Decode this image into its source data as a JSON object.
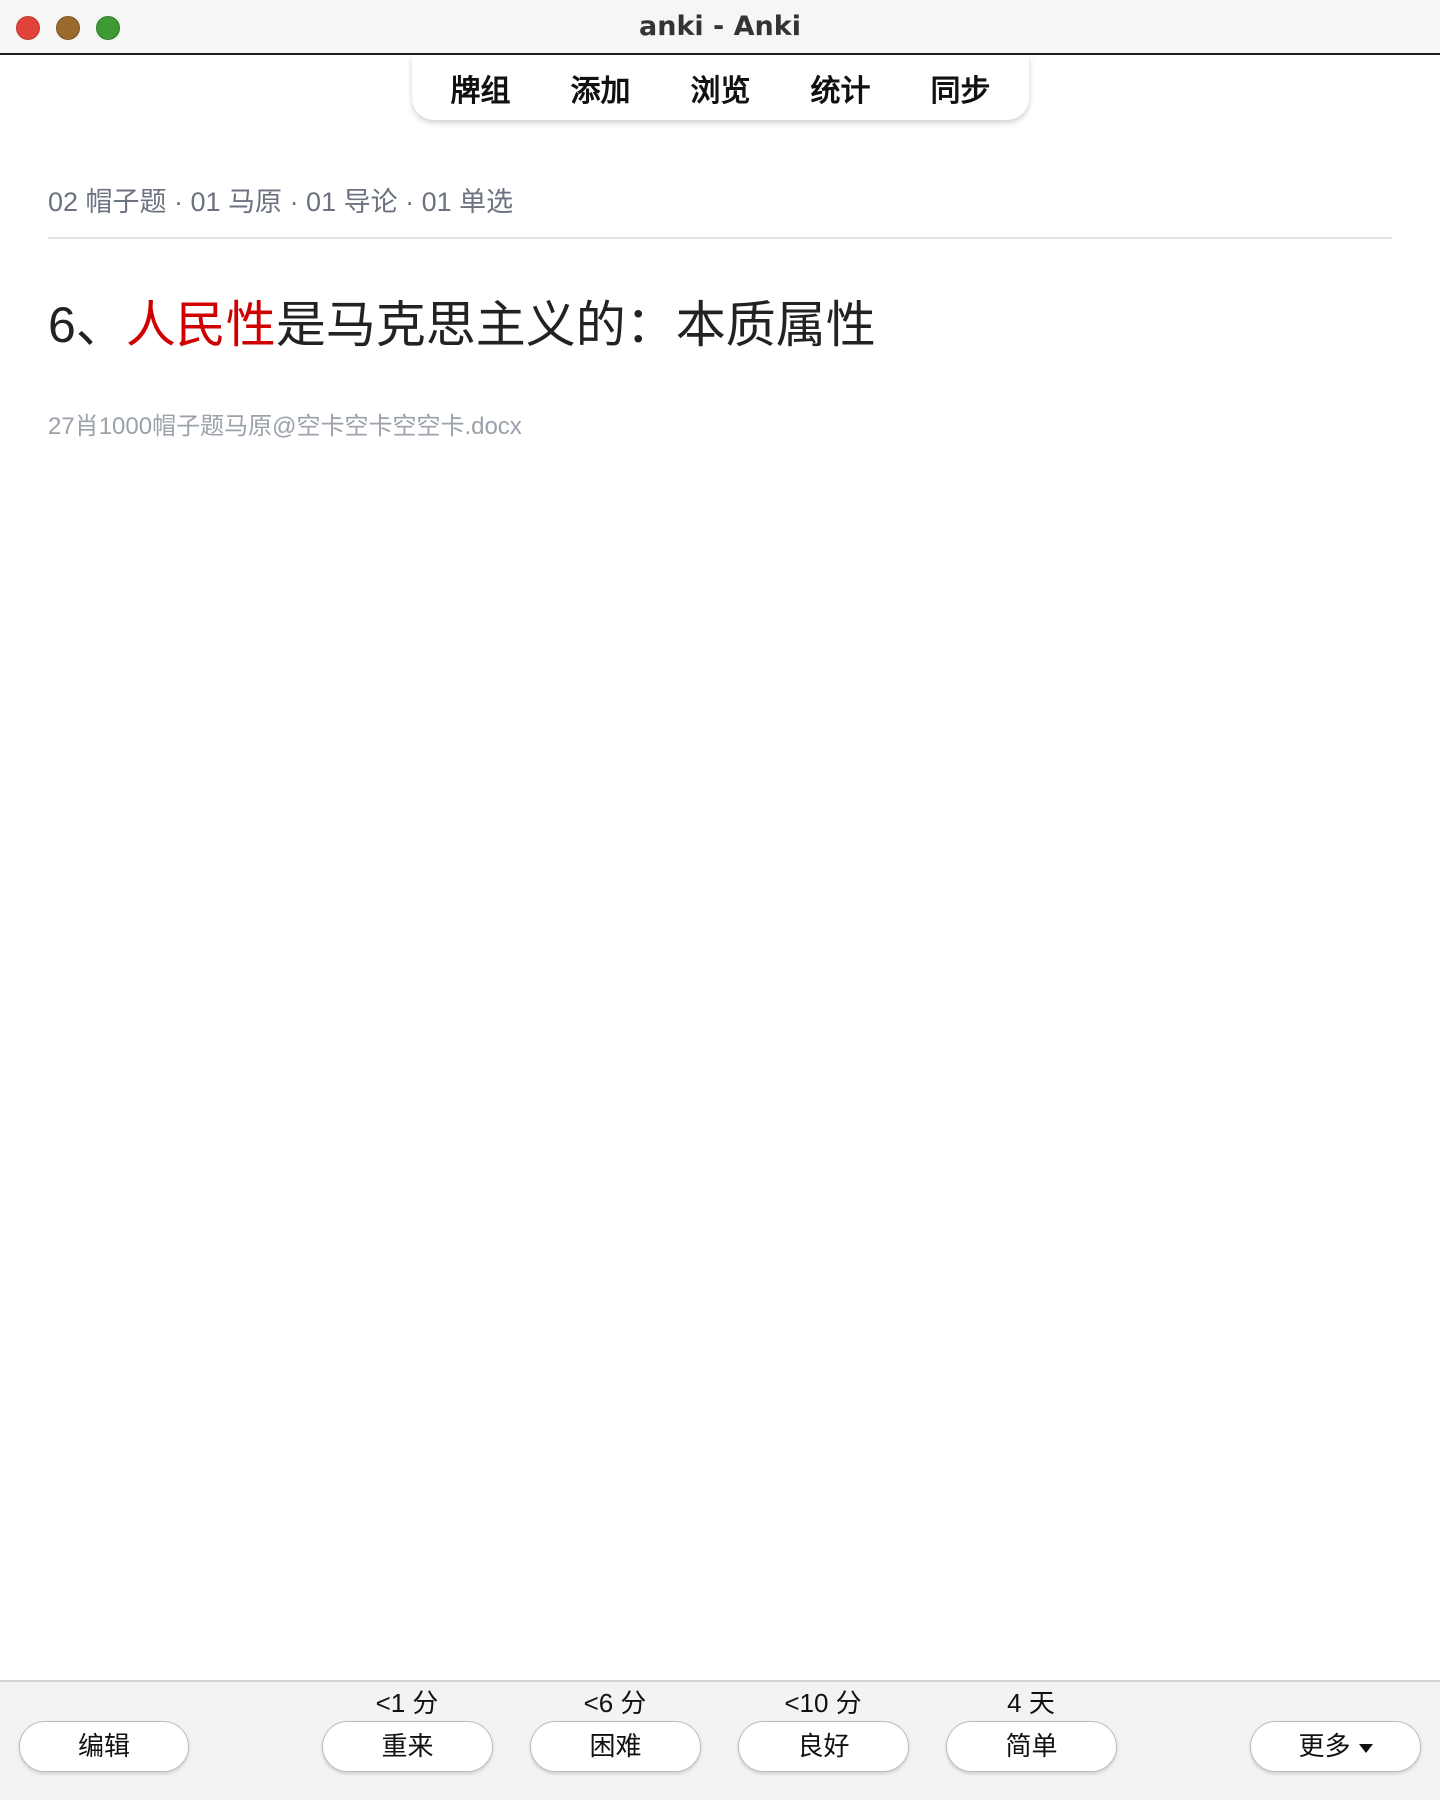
{
  "window": {
    "title": "anki - Anki"
  },
  "toolbar": {
    "tabs": [
      {
        "label": "牌组"
      },
      {
        "label": "添加"
      },
      {
        "label": "浏览"
      },
      {
        "label": "统计"
      },
      {
        "label": "同步"
      }
    ]
  },
  "card": {
    "breadcrumb": "02 帽子题 · 01 马原 · 01 导论 · 01 单选",
    "question": {
      "prefix": "6、",
      "highlight": "人民性",
      "rest": "是马克思主义的：本质属性"
    },
    "source": "27肖1000帽子题马原@空卡空卡空空卡.docx",
    "highlight_color": "#d10000"
  },
  "bottom_bar": {
    "edit_label": "编辑",
    "more_label": "更多",
    "answers": [
      {
        "label": "重来",
        "interval": "<1 分"
      },
      {
        "label": "困难",
        "interval": "<6 分"
      },
      {
        "label": "良好",
        "interval": "<10 分"
      },
      {
        "label": "简单",
        "interval": "4 天"
      }
    ]
  }
}
